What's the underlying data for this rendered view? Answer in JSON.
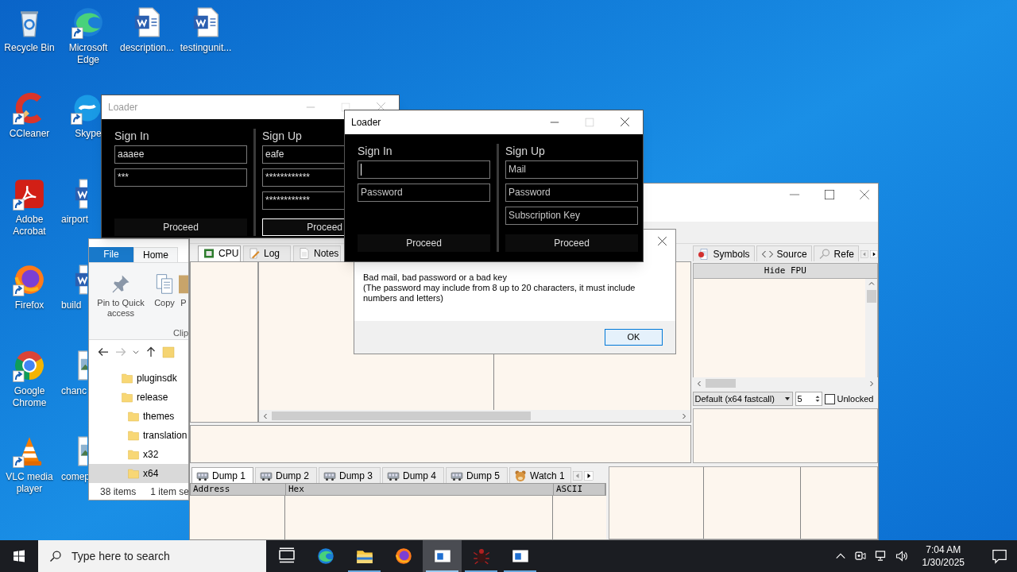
{
  "desktop_icons": [
    [
      {
        "label": "Recycle Bin",
        "kind": "recycle",
        "shortcut": false
      },
      {
        "label": "CCleaner",
        "kind": "cleaner",
        "shortcut": true
      },
      {
        "label": "Adobe Acrobat",
        "kind": "pdf",
        "shortcut": true
      },
      {
        "label": "Firefox",
        "kind": "firefox",
        "shortcut": true
      },
      {
        "label": "Google Chrome",
        "kind": "chrome",
        "shortcut": true
      },
      {
        "label": "VLC media player",
        "kind": "cone",
        "shortcut": true
      }
    ],
    [
      {
        "label": "Microsoft Edge",
        "kind": "edge",
        "shortcut": true
      },
      {
        "label": "Skype",
        "kind": "chat",
        "shortcut": true
      },
      {
        "label": "airport",
        "kind": "word",
        "shortcut": false
      },
      {
        "label": "build",
        "kind": "word",
        "shortcut": false
      },
      {
        "label": "chanc",
        "kind": "image",
        "shortcut": false
      },
      {
        "label": "comep",
        "kind": "image",
        "shortcut": false
      }
    ],
    [
      {
        "label": "description...",
        "kind": "word",
        "shortcut": false
      }
    ],
    [
      {
        "label": "testingunit...",
        "kind": "word",
        "shortcut": false
      }
    ]
  ],
  "explorer": {
    "ribbon_tabs": [
      {
        "label": "File",
        "kind": "file",
        "selected": false
      },
      {
        "label": "Home",
        "kind": "tab",
        "selected": true
      }
    ],
    "commands": [
      {
        "label": "Pin to Quick access",
        "kind": "pin"
      },
      {
        "label": "Copy",
        "kind": "copy"
      },
      {
        "label": "P",
        "kind": "paste"
      }
    ],
    "group": "Clip",
    "tree": [
      {
        "label": "pluginsdk",
        "selected": false
      },
      {
        "label": "release",
        "selected": false,
        "children": [
          {
            "label": "themes",
            "selected": false
          },
          {
            "label": "translation",
            "selected": false
          },
          {
            "label": "x32",
            "selected": false
          },
          {
            "label": "x64",
            "selected": true
          }
        ]
      }
    ],
    "status": [
      "38 items",
      "1 item se"
    ]
  },
  "debugger": {
    "cpu_tabs": [
      {
        "label": "CPU",
        "kind": "chip",
        "selected": true
      },
      {
        "label": "Log",
        "kind": "pencil",
        "selected": false
      },
      {
        "label": "Notes",
        "kind": "page",
        "selected": false
      }
    ],
    "side_tabs": [
      {
        "label": "Symbols",
        "kind": "symbols"
      },
      {
        "label": "Source",
        "kind": "code"
      },
      {
        "label": "Refe",
        "kind": "search"
      }
    ],
    "fpu_button": "Hide FPU",
    "calling_convention": "Default (x64 fastcall)",
    "arg_count": "5",
    "unlocked": {
      "label": "Unlocked",
      "checked": false
    },
    "dump_tabs": [
      {
        "label": "Dump 1",
        "kind": "dump",
        "selected": true
      },
      {
        "label": "Dump 2",
        "kind": "dump",
        "selected": false
      },
      {
        "label": "Dump 3",
        "kind": "dump",
        "selected": false
      },
      {
        "label": "Dump 4",
        "kind": "dump",
        "selected": false
      },
      {
        "label": "Dump 5",
        "kind": "dump",
        "selected": false
      },
      {
        "label": "Watch 1",
        "kind": "watch",
        "selected": false
      }
    ],
    "dump_columns": [
      "Address",
      "Hex",
      "ASCII"
    ]
  },
  "loader_windows": [
    {
      "title": "Loader",
      "active": false,
      "sign_in": {
        "heading": "Sign In",
        "fields": [
          {
            "value": "aaaee",
            "focused": false
          },
          {
            "value": "***",
            "focused": false
          }
        ],
        "button": {
          "label": "Proceed",
          "focused": false
        }
      },
      "sign_up": {
        "heading": "Sign Up",
        "fields": [
          {
            "value": "eafe",
            "focused": false
          },
          {
            "value": "************",
            "focused": false
          },
          {
            "value": "************",
            "focused": false
          }
        ],
        "button": {
          "label": "Proceed",
          "focused": true
        }
      }
    },
    {
      "title": "Loader",
      "active": true,
      "sign_in": {
        "heading": "Sign In",
        "fields": [
          {
            "focused": true
          },
          {
            "placeholder": "Password",
            "focused": false
          }
        ],
        "button": {
          "label": "Proceed",
          "focused": false
        }
      },
      "sign_up": {
        "heading": "Sign Up",
        "fields": [
          {
            "placeholder": "Mail",
            "focused": false
          },
          {
            "placeholder": "Password",
            "focused": false
          },
          {
            "placeholder": "Subscription Key",
            "focused": false
          }
        ],
        "button": {
          "label": "Proceed",
          "focused": false
        }
      }
    }
  ],
  "message_box": {
    "text": "Bad mail, bad password or a bad key",
    "detail": "(The password may include from 8 up to 20 characters, it must include numbers and letters)",
    "button": "OK"
  },
  "taskbar": {
    "search_placeholder": "Type here to search",
    "apps": [
      {
        "kind": "taskview",
        "running": false,
        "active": false
      },
      {
        "kind": "edge",
        "running": false,
        "active": false
      },
      {
        "kind": "folder",
        "running": true,
        "active": false
      },
      {
        "kind": "firefox",
        "running": false,
        "active": false
      },
      {
        "kind": "window",
        "running": true,
        "active": true
      },
      {
        "kind": "bug",
        "running": true,
        "active": false
      },
      {
        "kind": "window",
        "running": true,
        "active": false
      }
    ],
    "time": "7:04 AM",
    "date": "1/30/2025"
  }
}
